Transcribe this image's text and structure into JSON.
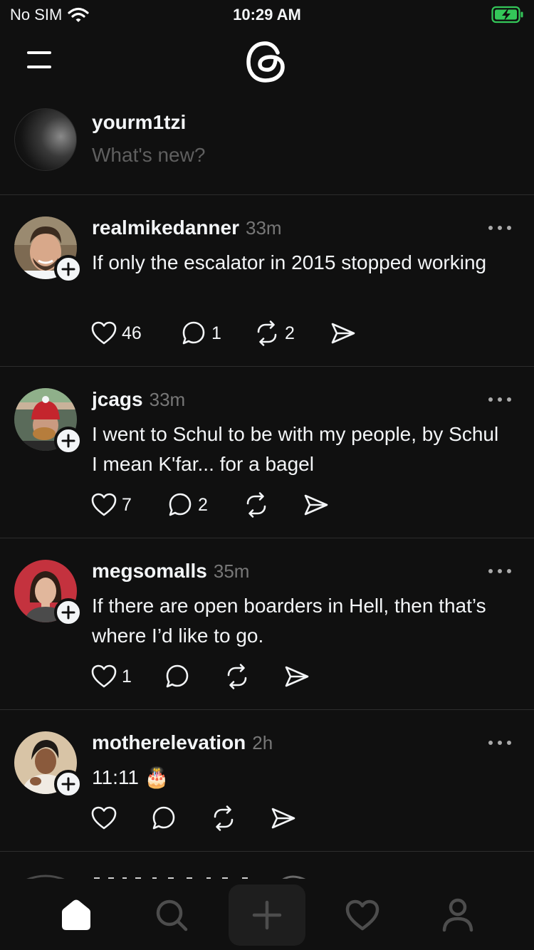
{
  "status_bar": {
    "carrier": "No SIM",
    "time": "10:29 AM"
  },
  "composer": {
    "username": "yourm1tzi",
    "placeholder": "What's new?"
  },
  "posts": [
    {
      "author": "realmikedanner",
      "time": "33m",
      "text": "If only the escalator in 2015 stopped working",
      "likes": "46",
      "replies": "1",
      "reposts": "2"
    },
    {
      "author": "jcags",
      "time": "33m",
      "text": "I went to Schul to be with my people, by Schul I mean K'far... for a bagel",
      "likes": "7",
      "replies": "2",
      "reposts": ""
    },
    {
      "author": "megsomalls",
      "time": "35m",
      "text": "If there are open boarders in Hell, then that’s where I’d like to go.",
      "likes": "1",
      "replies": "",
      "reposts": ""
    },
    {
      "author": "motherelevation",
      "time": "2h",
      "text": "11:11 🎂",
      "likes": "",
      "replies": "",
      "reposts": ""
    }
  ],
  "icons": {
    "menu": "menu-icon",
    "logo": "threads-logo",
    "like": "heart-icon",
    "reply": "comment-icon",
    "repost": "repost-icon",
    "share": "send-icon",
    "more": "more-icon",
    "follow": "plus-icon",
    "tabs": [
      "home-icon",
      "search-icon",
      "plus-icon",
      "heart-icon",
      "profile-icon"
    ]
  },
  "colors": {
    "background": "#101010",
    "text": "#f3f5f7",
    "secondary": "#777777",
    "divider": "#2d2d2d",
    "battery": "#34c759"
  }
}
